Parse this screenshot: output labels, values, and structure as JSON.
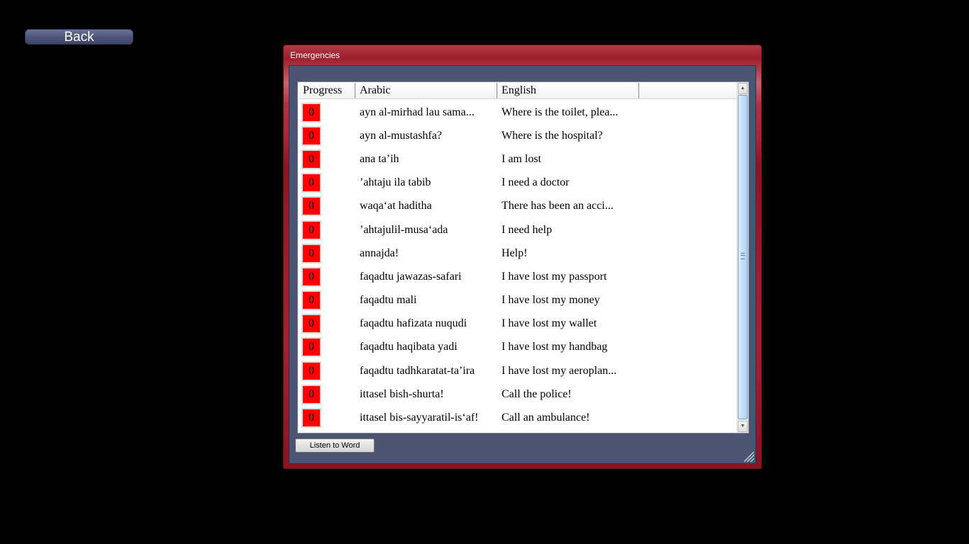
{
  "back_button": {
    "label": "Back"
  },
  "window": {
    "title": "Emergencies",
    "columns": [
      "Progress",
      "Arabic",
      "English"
    ],
    "rows": [
      {
        "progress": "0",
        "arabic": "ayn al-mirhad lau sama...",
        "english": "Where is the toilet, plea..."
      },
      {
        "progress": "0",
        "arabic": "ayn al-mustashfa?",
        "english": "Where is the hospital?"
      },
      {
        "progress": "0",
        "arabic": "ana ta’ih",
        "english": "I am lost"
      },
      {
        "progress": "0",
        "arabic": "’ahtaju ila tabib",
        "english": "I need a doctor"
      },
      {
        "progress": "0",
        "arabic": "waqa‘at haditha",
        "english": "There has been an acci..."
      },
      {
        "progress": "0",
        "arabic": "’ahtajulil-musa‘ada",
        "english": "I need help"
      },
      {
        "progress": "0",
        "arabic": "annajda!",
        "english": "Help!"
      },
      {
        "progress": "0",
        "arabic": "faqadtu jawazas-safari",
        "english": "I have lost my passport"
      },
      {
        "progress": "0",
        "arabic": "faqadtu mali",
        "english": "I have lost my money"
      },
      {
        "progress": "0",
        "arabic": "faqadtu hafizata nuqudi",
        "english": "I have lost my wallet"
      },
      {
        "progress": "0",
        "arabic": "faqadtu haqibata yadi",
        "english": "I have lost my handbag"
      },
      {
        "progress": "0",
        "arabic": "faqadtu tadhkaratat-ta’ira",
        "english": "I have lost my aeroplan..."
      },
      {
        "progress": "0",
        "arabic": "ittasel bish-shurta!",
        "english": "Call the police!"
      },
      {
        "progress": "0",
        "arabic": "ittasel bis-sayyaratil-is‘af!",
        "english": "Call an ambulance!"
      }
    ],
    "listen_button": "Listen to Word"
  },
  "colors": {
    "background": "#000000",
    "window_frame": "#9d1f2c",
    "client_area": "#4b5473",
    "progress_badge": "#ff0000"
  },
  "icons": {
    "scroll_up": "scroll-up-arrow-icon",
    "scroll_down": "scroll-down-arrow-icon",
    "resize": "resize-grip-icon"
  }
}
